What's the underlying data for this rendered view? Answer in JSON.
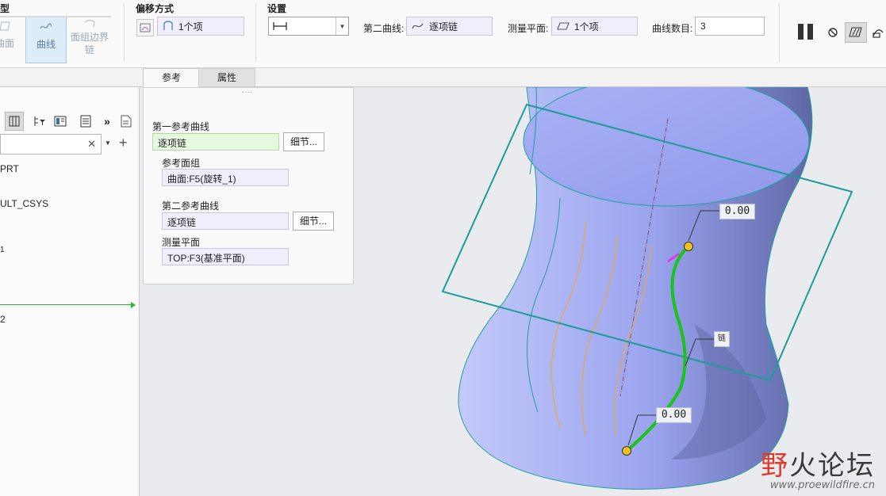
{
  "ribbon": {
    "group_ref_title": "型",
    "buttons": {
      "surface": "曲面",
      "curve": "曲线",
      "boundary": "面组边界链"
    },
    "offset_group": {
      "title": "偏移方式",
      "collector": "1个项"
    },
    "settings_group": {
      "title": "设置",
      "dropdown_value": "|—|"
    },
    "second_curve_label": "第二曲线:",
    "second_curve_value": "逐项链",
    "measure_plane_label": "测量平面:",
    "measure_plane_value": "1个项",
    "curve_count_label": "曲线数目:",
    "curve_count_value": "3"
  },
  "tabs": [
    {
      "label": "参考",
      "active": true
    },
    {
      "label": "属性",
      "active": false
    }
  ],
  "tree": {
    "items": [
      "PRT",
      "ULT_CSYS",
      "1",
      "2"
    ]
  },
  "ref_panel": {
    "grip": "····",
    "first_curve_label": "第一参考曲线",
    "first_curve_value": "逐项链",
    "detail_button": "细节...",
    "ref_quilt_label": "参考面组",
    "ref_quilt_value": "曲面:F5(旋转_1)",
    "second_curve_label": "第二参考曲线",
    "second_curve_value": "逐项链",
    "detail_button2": "细节...",
    "measure_plane_label": "测量平面",
    "measure_plane_value": "TOP:F3(基准平面)"
  },
  "viewport": {
    "tag_top": "0.00",
    "tag_mid": "链",
    "tag_bottom": "0.00"
  },
  "watermark": {
    "title_a": "野",
    "title_b": "火论坛",
    "url": "www.proewildfire.cn"
  },
  "colors": {
    "surface": "#9aa6ee",
    "plane": "#1d9a9a",
    "green_curve": "#18c41b",
    "orange_curve": "#e8a84a",
    "ribbon_bg": "#fafafa"
  }
}
